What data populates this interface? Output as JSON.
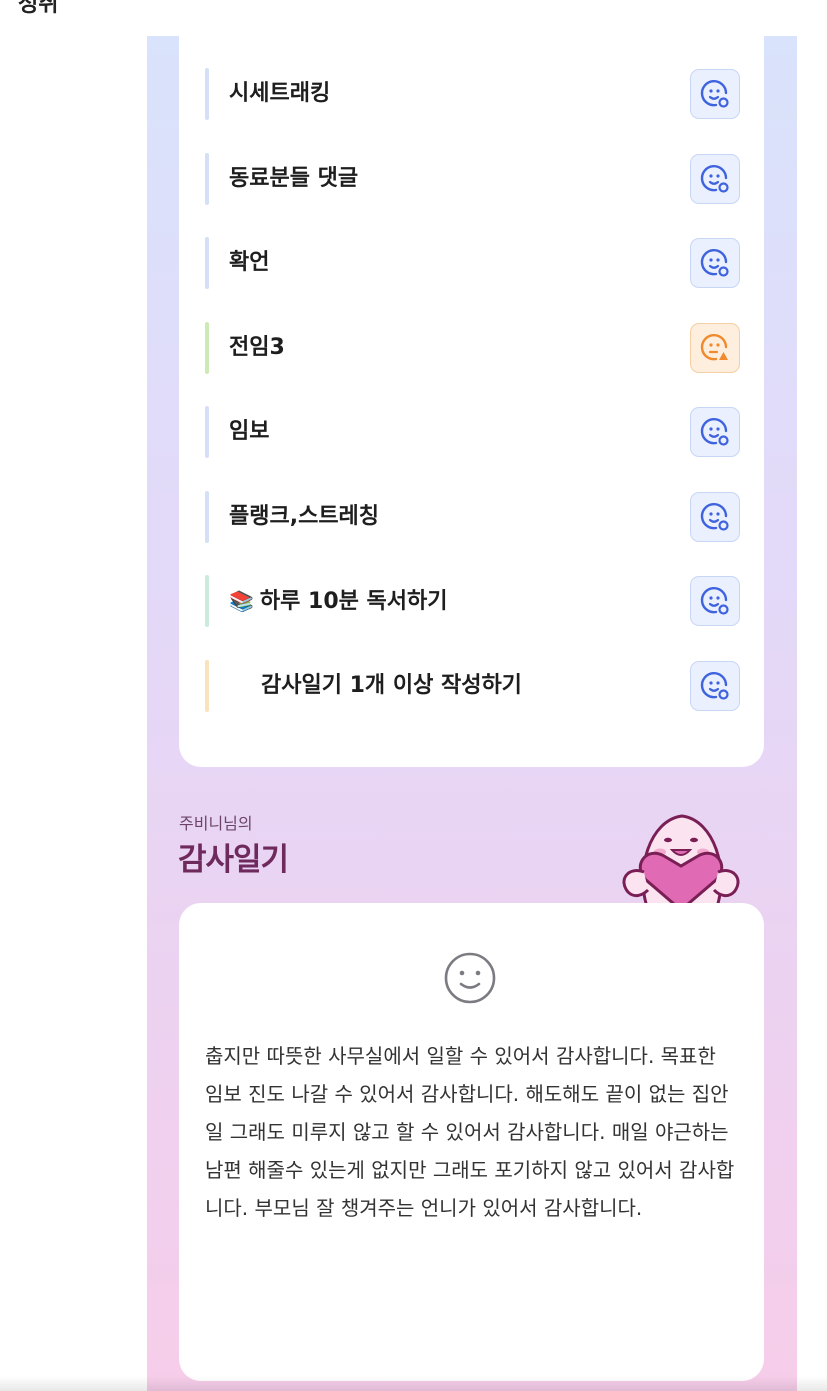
{
  "header": {
    "title": "성취"
  },
  "habits": {
    "items": [
      {
        "label": "시세트래킹",
        "bar_color": "#d6dff8",
        "status_icon": "smile-face-check-icon",
        "status_color": "#3f63de"
      },
      {
        "label": "동료분들 댓글",
        "bar_color": "#d6dff8",
        "status_icon": "smile-face-check-icon",
        "status_color": "#3f63de"
      },
      {
        "label": "확언",
        "bar_color": "#d6dff8",
        "status_icon": "smile-face-check-icon",
        "status_color": "#3f63de"
      },
      {
        "label": "전임3",
        "bar_color": "#cdeab5",
        "status_icon": "worried-face-warning-icon",
        "status_color": "#f08a2c"
      },
      {
        "label": "임보",
        "bar_color": "#d6dff8",
        "status_icon": "smile-face-check-icon",
        "status_color": "#3f63de"
      },
      {
        "label": "플랭크,스트레칭",
        "bar_color": "#d6dff8",
        "status_icon": "smile-face-check-icon",
        "status_color": "#3f63de"
      },
      {
        "label": "하루 10분 독서하기",
        "prefix_icon": "books-icon",
        "bar_color": "#c9ecdc",
        "status_icon": "smile-face-check-icon",
        "status_color": "#3f63de"
      },
      {
        "label": "감사일기 1개 이상 작성하기",
        "bar_color": "#fbe1bc",
        "status_icon": "smile-face-check-icon",
        "status_color": "#3f63de"
      }
    ]
  },
  "diary": {
    "owner_label": "주비니님의",
    "title": "감사일기",
    "mascot_icon": "heart-hugging-mascot",
    "mood_icon": "smile-face-icon",
    "text": "춥지만 따뜻한 사무실에서 일할 수 있어서 감사합니다.\n목표한 임보 진도 나갈 수 있어서 감사합니다.\n해도해도 끝이 없는 집안일 그래도 미루지 않고 할 수 있어서 감사합니다.\n매일 야근하는 남편 해줄수 있는게 없지만 그래도 포기하지 않고 있어서 감사합니다.\n부모님 잘 챙겨주는 언니가 있어서 감사합니다."
  },
  "colors": {
    "accent_blue": "#3f63de",
    "accent_orange": "#f08a2c",
    "diary_title": "#6f2a5d",
    "mascot_pink": "#e06bb4"
  }
}
